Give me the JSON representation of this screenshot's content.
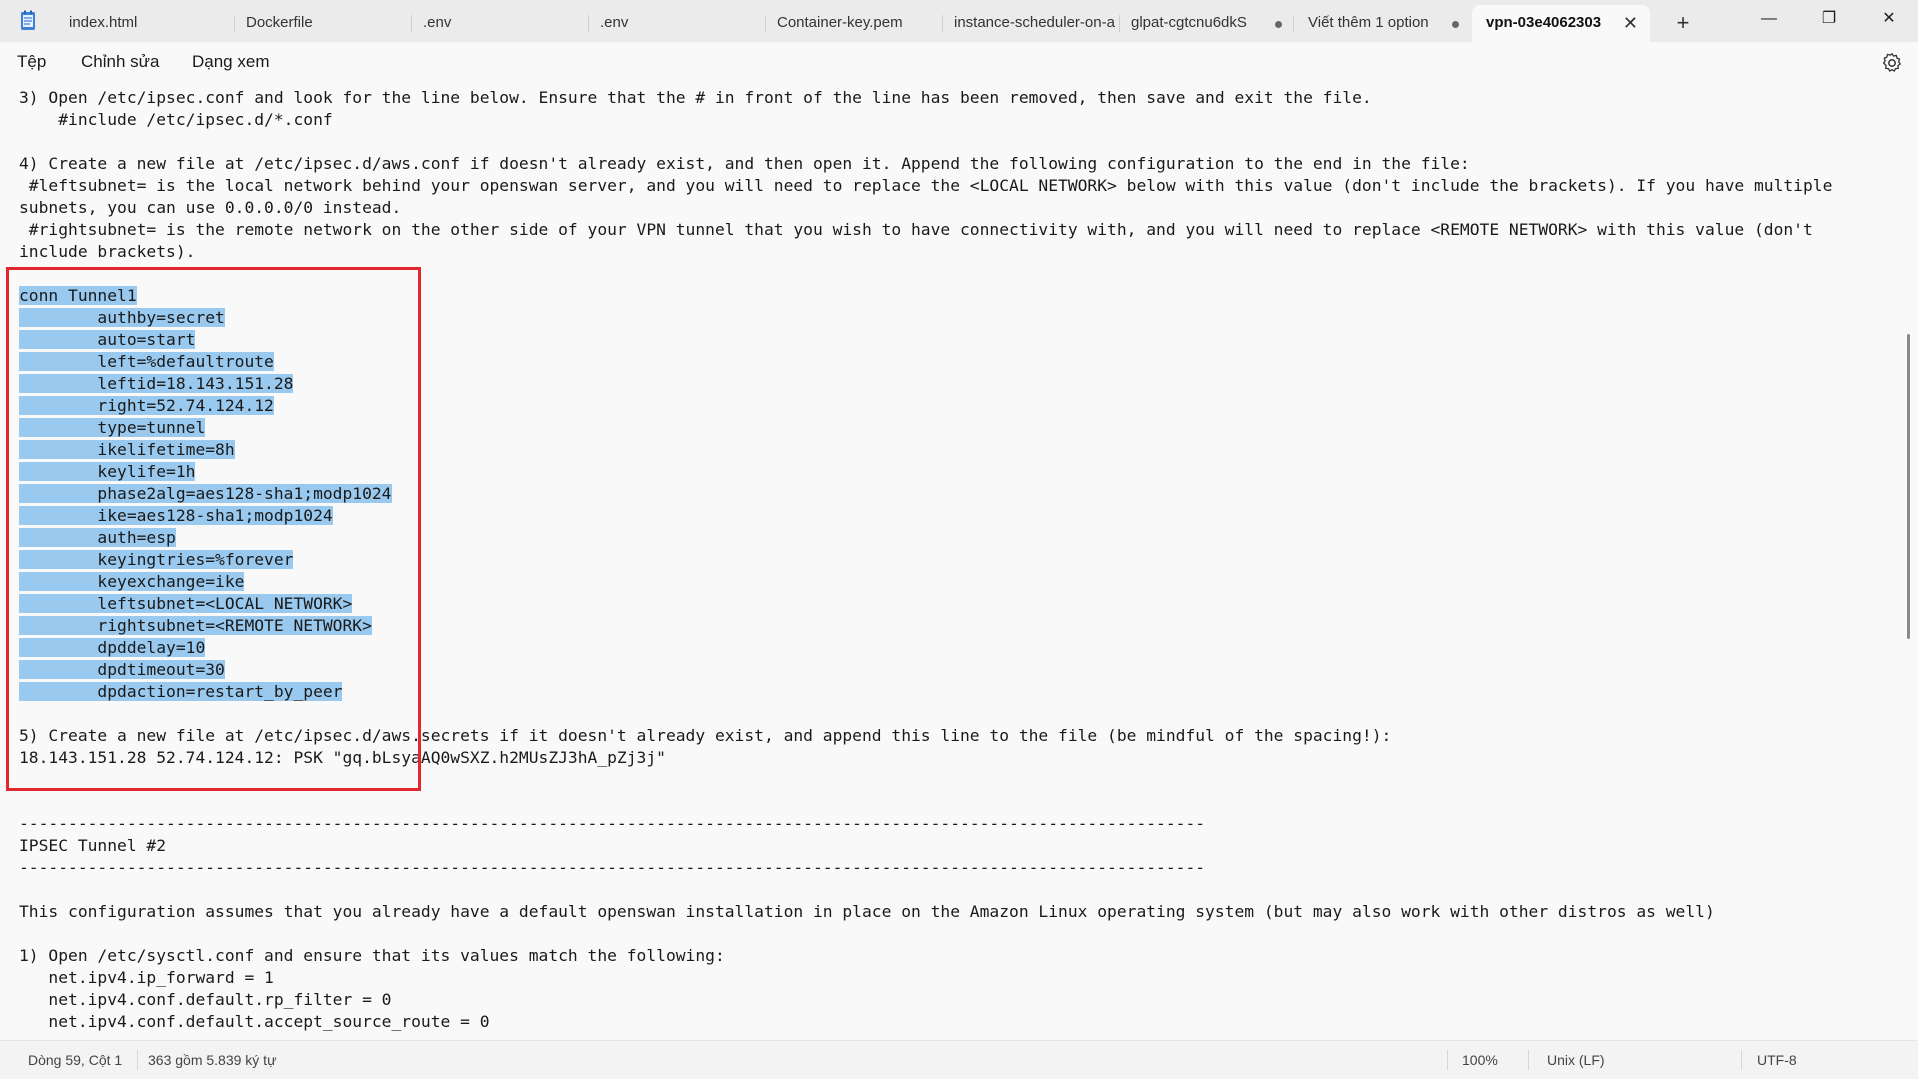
{
  "tabs": [
    {
      "label": "index.html"
    },
    {
      "label": "Dockerfile"
    },
    {
      "label": ".env"
    },
    {
      "label": ".env"
    },
    {
      "label": "Container-key.pem"
    },
    {
      "label": "instance-scheduler-on-a"
    },
    {
      "label": "glpat-cgtcnu6dkS"
    },
    {
      "label": "Viết thêm 1 option"
    },
    {
      "label": "vpn-03e4062303"
    }
  ],
  "menu": {
    "file": "Tệp",
    "edit": "Chỉnh sửa",
    "view": "Dạng xem"
  },
  "lines": [
    "3) Open /etc/ipsec.conf and look for the line below. Ensure that the # in front of the line has been removed, then save and exit the file.",
    "    #include /etc/ipsec.d/*.conf",
    "",
    "4) Create a new file at /etc/ipsec.d/aws.conf if doesn't already exist, and then open it. Append the following configuration to the end in the file:",
    " #leftsubnet= is the local network behind your openswan server, and you will need to replace the <LOCAL NETWORK> below with this value (don't include the brackets). If you have multiple",
    "subnets, you can use 0.0.0.0/0 instead.",
    " #rightsubnet= is the remote network on the other side of your VPN tunnel that you wish to have connectivity with, and you will need to replace <REMOTE NETWORK> with this value (don't",
    "include brackets).",
    ""
  ],
  "selected_lines": [
    "conn Tunnel1",
    "\tauthby=secret",
    "\tauto=start",
    "\tleft=%defaultroute",
    "\tleftid=18.143.151.28",
    "\tright=52.74.124.12",
    "\ttype=tunnel",
    "\tikelifetime=8h",
    "\tkeylife=1h",
    "\tphase2alg=aes128-sha1;modp1024",
    "\tike=aes128-sha1;modp1024",
    "\tauth=esp",
    "\tkeyingtries=%forever",
    "\tkeyexchange=ike",
    "\tleftsubnet=<LOCAL NETWORK>",
    "\trightsubnet=<REMOTE NETWORK>",
    "\tdpddelay=10",
    "\tdpdtimeout=30",
    "\tdpdaction=restart_by_peer"
  ],
  "lines_after": [
    "",
    "5) Create a new file at /etc/ipsec.d/aws.secrets if it doesn't already exist, and append this line to the file (be mindful of the spacing!):",
    "18.143.151.28 52.74.124.12: PSK \"gq.bLsyaAQ0wSXZ.h2MUsZJ3hA_pZj3j\"",
    "",
    "",
    "-------------------------------------------------------------------------------------------------------------------------",
    "IPSEC Tunnel #2",
    "-------------------------------------------------------------------------------------------------------------------------",
    "",
    "This configuration assumes that you already have a default openswan installation in place on the Amazon Linux operating system (but may also work with other distros as well)",
    "",
    "1) Open /etc/sysctl.conf and ensure that its values match the following:",
    "   net.ipv4.ip_forward = 1",
    "   net.ipv4.conf.default.rp_filter = 0",
    "   net.ipv4.conf.default.accept_source_route = 0"
  ],
  "status": {
    "position": "Dòng 59, Cột 1",
    "selection": "363 gồm 5.839 ký tự",
    "zoom": "100%",
    "line_ending": "Unix (LF)",
    "encoding": "UTF-8"
  }
}
